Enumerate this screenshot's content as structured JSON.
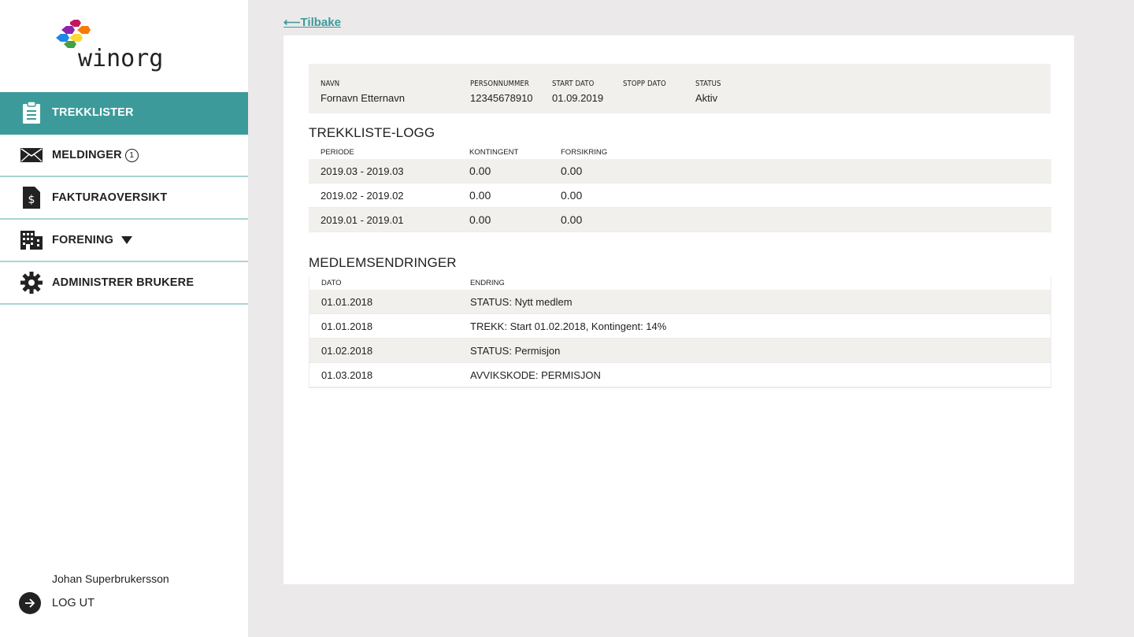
{
  "brand": {
    "name": "winorg"
  },
  "back_link": "⟵Tilbake",
  "nav": [
    {
      "label": "TREKKLISTER",
      "icon": "clipboard-icon",
      "active": true
    },
    {
      "label": "MELDINGER",
      "icon": "envelope-icon",
      "badge": "1"
    },
    {
      "label": "FAKTURAOVERSIKT",
      "icon": "invoice-dollar-icon"
    },
    {
      "label": "FORENING",
      "icon": "building-icon",
      "has_dropdown": true
    },
    {
      "label": "ADMINISTRER BRUKERE",
      "icon": "gear-icon"
    }
  ],
  "user": {
    "name": "Johan Superbrukersson",
    "logout_label": "LOG UT"
  },
  "member": {
    "headers": {
      "name": "NAVN",
      "personnummer": "PERSONNUMMER",
      "start": "START DATO",
      "stop": "STOPP DATO",
      "status": "STATUS"
    },
    "values": {
      "name": "Fornavn Etternavn",
      "personnummer": "12345678910",
      "start": "01.09.2019",
      "stop": "",
      "status": "Aktiv"
    }
  },
  "trekkliste_logg": {
    "title": "TREKKLISTE-LOGG",
    "columns": [
      "PERIODE",
      "KONTINGENT",
      "FORSIKRING"
    ],
    "rows": [
      [
        "2019.03 - 2019.03",
        "0.00",
        "0.00"
      ],
      [
        "2019.02 - 2019.02",
        "0.00",
        "0.00"
      ],
      [
        "2019.01 - 2019.01",
        "0.00",
        "0.00"
      ]
    ]
  },
  "medlemsendringer": {
    "title": "MEDLEMSENDRINGER",
    "columns": [
      "DATO",
      "ENDRING"
    ],
    "rows": [
      [
        "01.01.2018",
        "STATUS: Nytt medlem"
      ],
      [
        "01.01.2018",
        "TREKK: Start 01.02.2018, Kontingent: 14%"
      ],
      [
        "01.02.2018",
        "STATUS: Permisjon"
      ],
      [
        "01.03.2018",
        "AVVIKSKODE: PERMISJON"
      ]
    ]
  },
  "colors": {
    "accent": "#3c9b9a",
    "background": "#ebe9e9",
    "row_alt": "#f1f0ec"
  }
}
